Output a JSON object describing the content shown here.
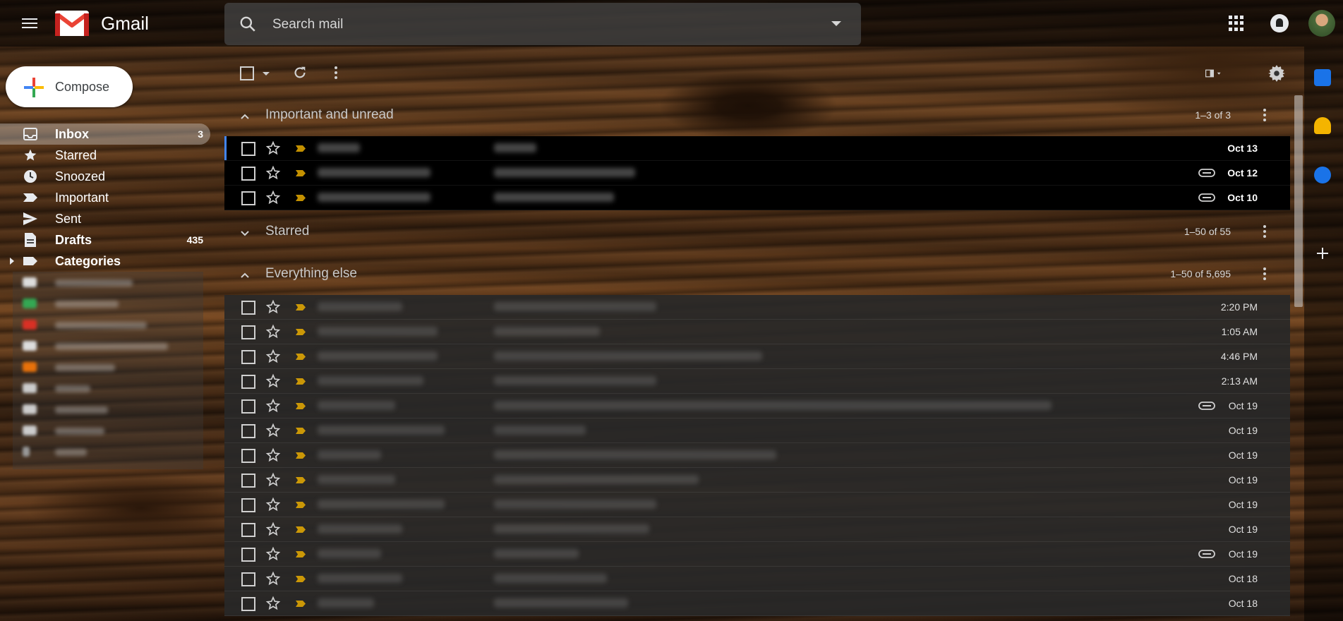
{
  "app": {
    "name": "Gmail"
  },
  "search": {
    "placeholder": "Search mail"
  },
  "compose": {
    "label": "Compose"
  },
  "nav": [
    {
      "label": "Inbox",
      "count": "3",
      "icon": "inbox-icon",
      "active": true,
      "bold": true
    },
    {
      "label": "Starred",
      "count": "",
      "icon": "star-icon",
      "active": false,
      "bold": false
    },
    {
      "label": "Snoozed",
      "count": "",
      "icon": "clock-icon",
      "active": false,
      "bold": false
    },
    {
      "label": "Important",
      "count": "",
      "icon": "important-icon",
      "active": false,
      "bold": false
    },
    {
      "label": "Sent",
      "count": "",
      "icon": "send-icon",
      "active": false,
      "bold": false
    },
    {
      "label": "Drafts",
      "count": "435",
      "icon": "draft-icon",
      "active": false,
      "bold": true
    },
    {
      "label": "Categories",
      "count": "",
      "icon": "label-icon",
      "active": false,
      "bold": true
    }
  ],
  "sections": [
    {
      "title": "Important and unread",
      "range": "1–3 of 3",
      "expanded": true
    },
    {
      "title": "Starred",
      "range": "1–50 of 55",
      "expanded": false
    },
    {
      "title": "Everything else",
      "range": "1–50 of 5,695",
      "expanded": true
    }
  ],
  "important_unread": [
    {
      "date": "Oct 13",
      "attachment": false
    },
    {
      "date": "Oct 12",
      "attachment": true
    },
    {
      "date": "Oct 10",
      "attachment": true
    }
  ],
  "everything_else": [
    {
      "date": "2:20 PM",
      "attachment": false
    },
    {
      "date": "1:05 AM",
      "attachment": false
    },
    {
      "date": "4:46 PM",
      "attachment": false
    },
    {
      "date": "2:13 AM",
      "attachment": false
    },
    {
      "date": "Oct 19",
      "attachment": true
    },
    {
      "date": "Oct 19",
      "attachment": false
    },
    {
      "date": "Oct 19",
      "attachment": false
    },
    {
      "date": "Oct 19",
      "attachment": false
    },
    {
      "date": "Oct 19",
      "attachment": false
    },
    {
      "date": "Oct 19",
      "attachment": false
    },
    {
      "date": "Oct 19",
      "attachment": true
    },
    {
      "date": "Oct 18",
      "attachment": false
    },
    {
      "date": "Oct 18",
      "attachment": false
    }
  ],
  "colors": {
    "brand_red": "#ea4335",
    "important_yellow": "#f4b400",
    "unread_row": "#000000",
    "read_row": "#282828"
  }
}
